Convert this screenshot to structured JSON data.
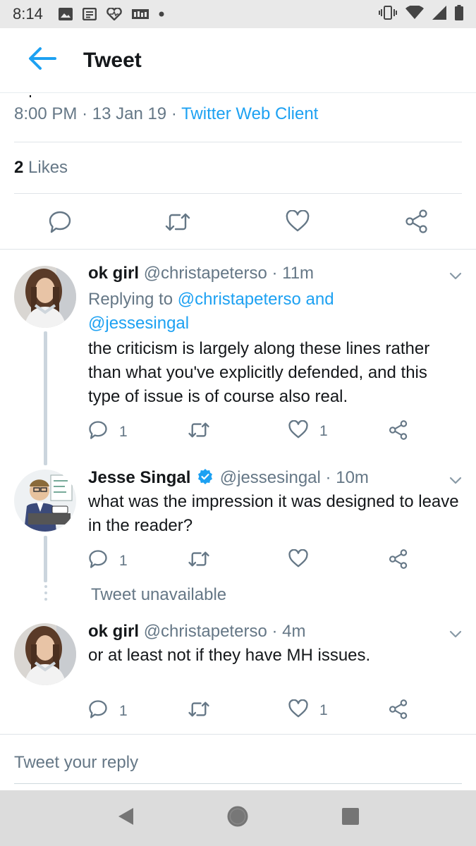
{
  "status_bar": {
    "time": "8:14",
    "icons": [
      "photo-icon",
      "news-icon",
      "heart-pulse-icon",
      "radio-icon",
      "dot-icon",
      "vibrate-icon",
      "wifi-icon",
      "cell-signal-icon",
      "battery-icon"
    ]
  },
  "app_bar": {
    "back_icon": "arrow-left-icon",
    "title": "Tweet"
  },
  "main_tweet": {
    "timestamp": "8:00 PM",
    "separator": "·",
    "date": "13 Jan 19",
    "client": "Twitter Web Client",
    "likes_count": "2",
    "likes_label": "Likes"
  },
  "replies": [
    {
      "name": "ok girl",
      "handle": "@christapeterso",
      "time": "11m",
      "replying_prefix": "Replying to",
      "replying_to": "@christapeterso and",
      "replying_to_2": "@jessesingal",
      "text": "the criticism is largely along these lines rather than what you've explicitly defended, and this type of issue is of course also real.",
      "reply_count": "1",
      "retweet_count": "",
      "like_count": "1"
    },
    {
      "name": "Jesse Singal",
      "verified": true,
      "handle": "@jessesingal",
      "time": "10m",
      "text": "what was the impression it was designed to leave in the reader?",
      "reply_count": "1",
      "retweet_count": "",
      "like_count": ""
    },
    {
      "name": "ok girl",
      "handle": "@christapeterso",
      "time": "4m",
      "text": "or at least not if they have MH issues.",
      "reply_count": "1",
      "retweet_count": "",
      "like_count": "1"
    }
  ],
  "tweet_unavailable": "Tweet unavailable",
  "reply_placeholder": "Tweet your reply",
  "colors": {
    "accent": "#1da1f2",
    "secondary_text": "#657786",
    "primary_text": "#14171a",
    "divider": "#dfe4e8"
  },
  "nav_bar": {
    "icons": [
      "back-triangle-icon",
      "home-circle-icon",
      "recents-square-icon"
    ]
  }
}
